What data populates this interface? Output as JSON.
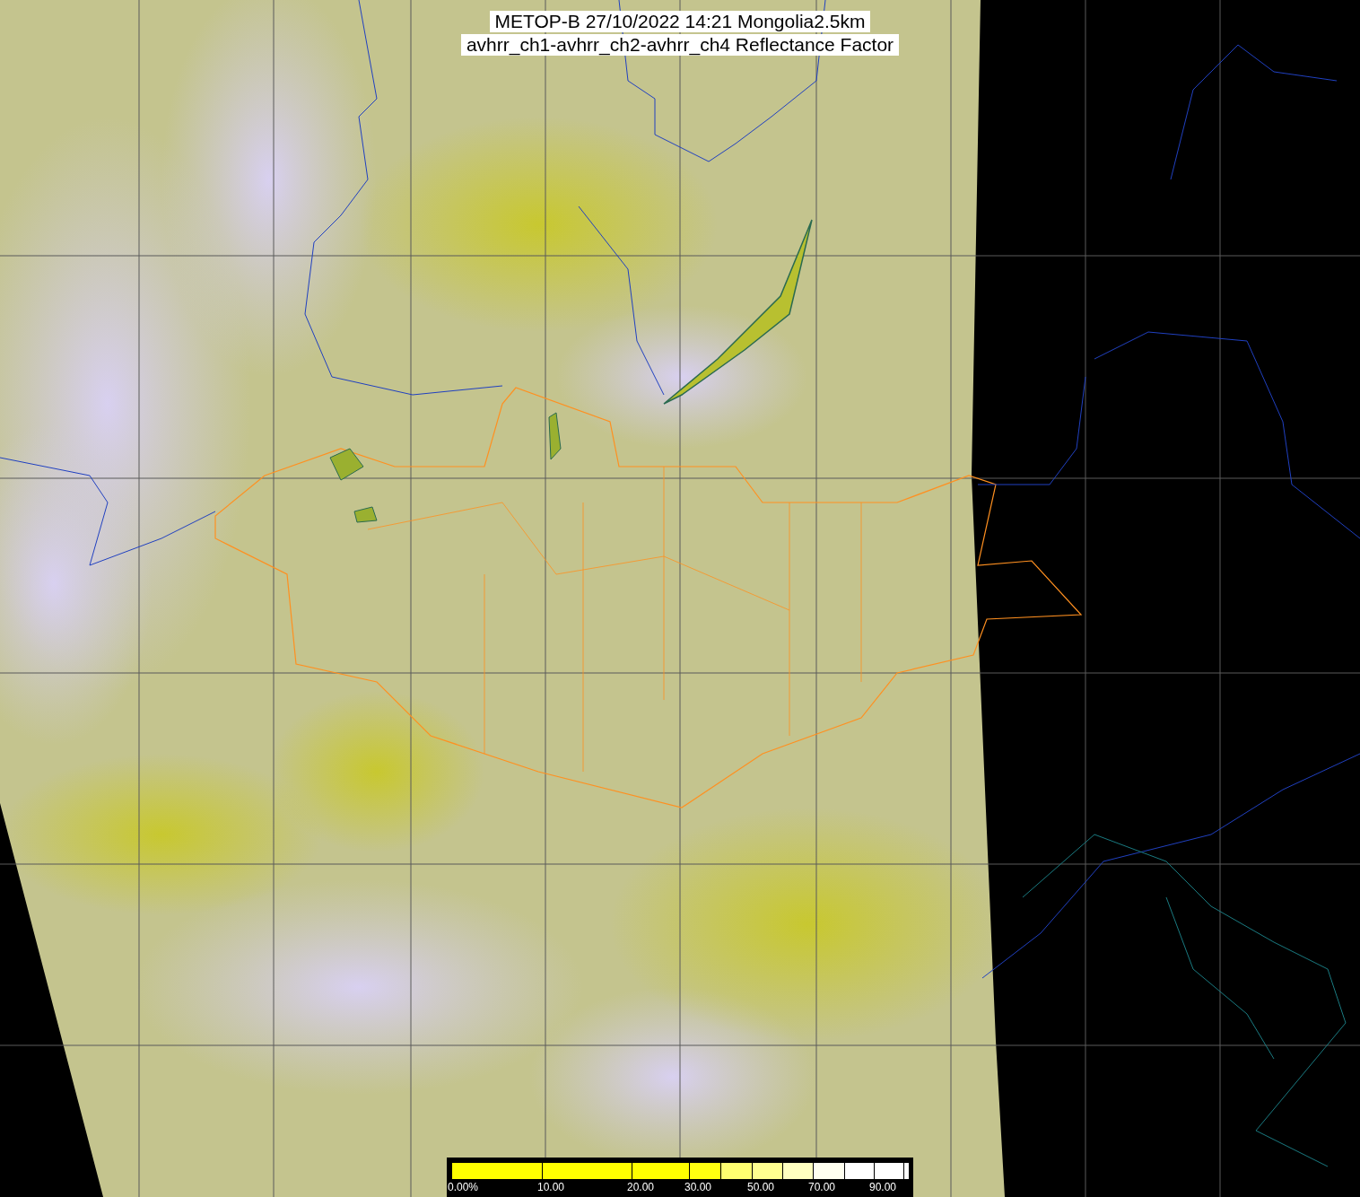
{
  "title": {
    "lines": [
      "METOP-B 27/10/2022 14:21 Mongolia2.5km",
      "avhrr_ch1-avhrr_ch2-avhrr_ch4 Reflectance Factor"
    ]
  },
  "colorbar": {
    "segments": [
      {
        "color": "#ffff00",
        "label": "0.00%"
      },
      {
        "color": "#ffff00",
        "label": "10.00"
      },
      {
        "color": "#ffff00",
        "label": "20.00"
      },
      {
        "color": "#ffff10",
        "label": "30.00"
      },
      {
        "color": "#ffff70"
      },
      {
        "color": "#ffff90",
        "label": "50.00"
      },
      {
        "color": "#ffffc0"
      },
      {
        "color": "#fffff0",
        "label": "70.00"
      },
      {
        "color": "#ffffff"
      },
      {
        "color": "#ffffff",
        "label": "90.00"
      },
      {
        "color": "#ffffff"
      }
    ]
  }
}
